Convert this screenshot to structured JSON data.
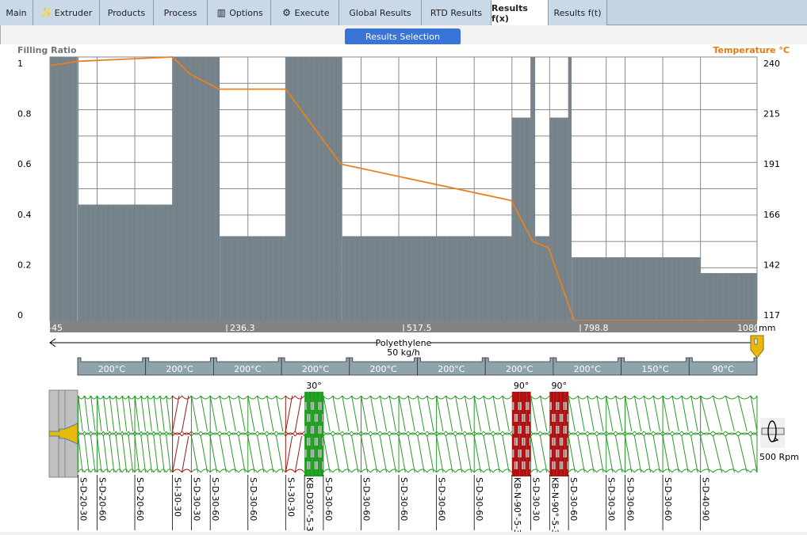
{
  "tabs": [
    {
      "label": "Main",
      "icon": ""
    },
    {
      "label": "Extruder",
      "icon": "magic-wand-icon"
    },
    {
      "label": "Products",
      "icon": ""
    },
    {
      "label": "Process",
      "icon": ""
    },
    {
      "label": "Options",
      "icon": "equalizer-icon"
    },
    {
      "label": "Execute",
      "icon": "gear-icon"
    },
    {
      "label": "Global Results",
      "icon": ""
    },
    {
      "label": "RTD Results",
      "icon": ""
    },
    {
      "label": "Results f(x)",
      "icon": "",
      "active": true
    },
    {
      "label": "Results f(t)",
      "icon": ""
    }
  ],
  "results_selection_label": "Results Selection",
  "chart_data": {
    "type": "bar+line",
    "left_axis_title": "Filling Ratio",
    "right_axis_title": "Temperature  °C",
    "x_unit": "mm",
    "xlim": [
      -45,
      1080
    ],
    "x_ticks": [
      "-45",
      "236.3",
      "517.5",
      "798.8",
      "1080"
    ],
    "ylim_left": [
      0,
      1
    ],
    "y_ticks_left": [
      "0",
      "0.2",
      "0.4",
      "0.6",
      "0.8",
      "1"
    ],
    "ylim_right": [
      117,
      240
    ],
    "y_ticks_right": [
      "117",
      "142",
      "166",
      "191",
      "215",
      "240"
    ],
    "grid": true,
    "filling_ratio": [
      {
        "from": -45,
        "to": 0,
        "value": 1.0
      },
      {
        "from": 0,
        "to": 150,
        "value": 0.44
      },
      {
        "from": 150,
        "to": 225,
        "value": 1.0
      },
      {
        "from": 225,
        "to": 330,
        "value": 0.32
      },
      {
        "from": 330,
        "to": 420,
        "value": 1.0
      },
      {
        "from": 420,
        "to": 690,
        "value": 0.32
      },
      {
        "from": 690,
        "to": 720,
        "value": 0.77
      },
      {
        "from": 720,
        "to": 727,
        "value": 1.0
      },
      {
        "from": 727,
        "to": 750,
        "value": 0.32
      },
      {
        "from": 750,
        "to": 780,
        "value": 0.77
      },
      {
        "from": 780,
        "to": 785,
        "value": 1.0
      },
      {
        "from": 785,
        "to": 990,
        "value": 0.24
      },
      {
        "from": 990,
        "to": 1080,
        "value": 0.18
      }
    ],
    "temperature": [
      {
        "x": -45,
        "y": 236
      },
      {
        "x": 0,
        "y": 238
      },
      {
        "x": 150,
        "y": 240
      },
      {
        "x": 178,
        "y": 232
      },
      {
        "x": 224,
        "y": 225
      },
      {
        "x": 330,
        "y": 225
      },
      {
        "x": 418,
        "y": 190
      },
      {
        "x": 689,
        "y": 173
      },
      {
        "x": 723,
        "y": 154
      },
      {
        "x": 748,
        "y": 151
      },
      {
        "x": 789,
        "y": 117
      },
      {
        "x": 1080,
        "y": 117
      }
    ],
    "colors": {
      "filling": "#77848c",
      "temperature": "#e8801e",
      "title_left": "#6b7780",
      "title_right": "#e07b10"
    }
  },
  "feed": {
    "material": "Polyethylene",
    "rate": "50 kg/h"
  },
  "barrel_zones": [
    "200°C",
    "200°C",
    "200°C",
    "200°C",
    "200°C",
    "200°C",
    "200°C",
    "200°C",
    "150°C",
    "90°C"
  ],
  "screw_speed": "500 Rpm",
  "screw_elements": [
    {
      "label": "S-D-20-30",
      "kind": "conveying",
      "pitch_mm": 20,
      "length_mm": 30
    },
    {
      "label": "S-D-20-60",
      "kind": "conveying",
      "pitch_mm": 20,
      "length_mm": 60
    },
    {
      "label": "S-D-20-60",
      "kind": "conveying",
      "pitch_mm": 20,
      "length_mm": 60
    },
    {
      "label": "S-I-30-30",
      "kind": "reverse",
      "pitch_mm": 30,
      "length_mm": 30
    },
    {
      "label": "S-D-30-30",
      "kind": "conveying",
      "pitch_mm": 30,
      "length_mm": 30
    },
    {
      "label": "S-D-30-60",
      "kind": "conveying",
      "pitch_mm": 30,
      "length_mm": 60
    },
    {
      "label": "S-D-30-60",
      "kind": "conveying",
      "pitch_mm": 30,
      "length_mm": 60
    },
    {
      "label": "S-I-30-30",
      "kind": "reverse",
      "pitch_mm": 30,
      "length_mm": 30
    },
    {
      "label": "KB-D30°-5-3",
      "kind": "kneading-forward",
      "angle": "30°",
      "length_mm": 30
    },
    {
      "label": "S-D-30-60",
      "kind": "conveying",
      "pitch_mm": 30,
      "length_mm": 60
    },
    {
      "label": "S-D-30-60",
      "kind": "conveying",
      "pitch_mm": 30,
      "length_mm": 60
    },
    {
      "label": "S-D-30-60",
      "kind": "conveying",
      "pitch_mm": 30,
      "length_mm": 60
    },
    {
      "label": "S-D-30-60",
      "kind": "conveying",
      "pitch_mm": 30,
      "length_mm": 60
    },
    {
      "label": "S-D-30-60",
      "kind": "conveying",
      "pitch_mm": 30,
      "length_mm": 60
    },
    {
      "label": "KB-N-90°-5-3",
      "kind": "kneading-neutral",
      "angle": "90°",
      "length_mm": 30
    },
    {
      "label": "S-D-30-30",
      "kind": "conveying",
      "pitch_mm": 30,
      "length_mm": 30
    },
    {
      "label": "KB-N-90°-5-3",
      "kind": "kneading-neutral",
      "angle": "90°",
      "length_mm": 30
    },
    {
      "label": "S-D-30-60",
      "kind": "conveying",
      "pitch_mm": 30,
      "length_mm": 60
    },
    {
      "label": "S-D-30-30",
      "kind": "conveying",
      "pitch_mm": 30,
      "length_mm": 30
    },
    {
      "label": "S-D-30-60",
      "kind": "conveying",
      "pitch_mm": 30,
      "length_mm": 60
    },
    {
      "label": "S-D-30-60",
      "kind": "conveying",
      "pitch_mm": 30,
      "length_mm": 60
    },
    {
      "label": "S-D-40-90",
      "kind": "conveying",
      "pitch_mm": 40,
      "length_mm": 90
    }
  ],
  "element_colors": {
    "conveying": "#2a9a2a",
    "reverse": "#a01818",
    "kneading-forward": "#1e9e1e",
    "kneading-neutral": "#b01010",
    "disc_gap": "#b8b8b8"
  }
}
